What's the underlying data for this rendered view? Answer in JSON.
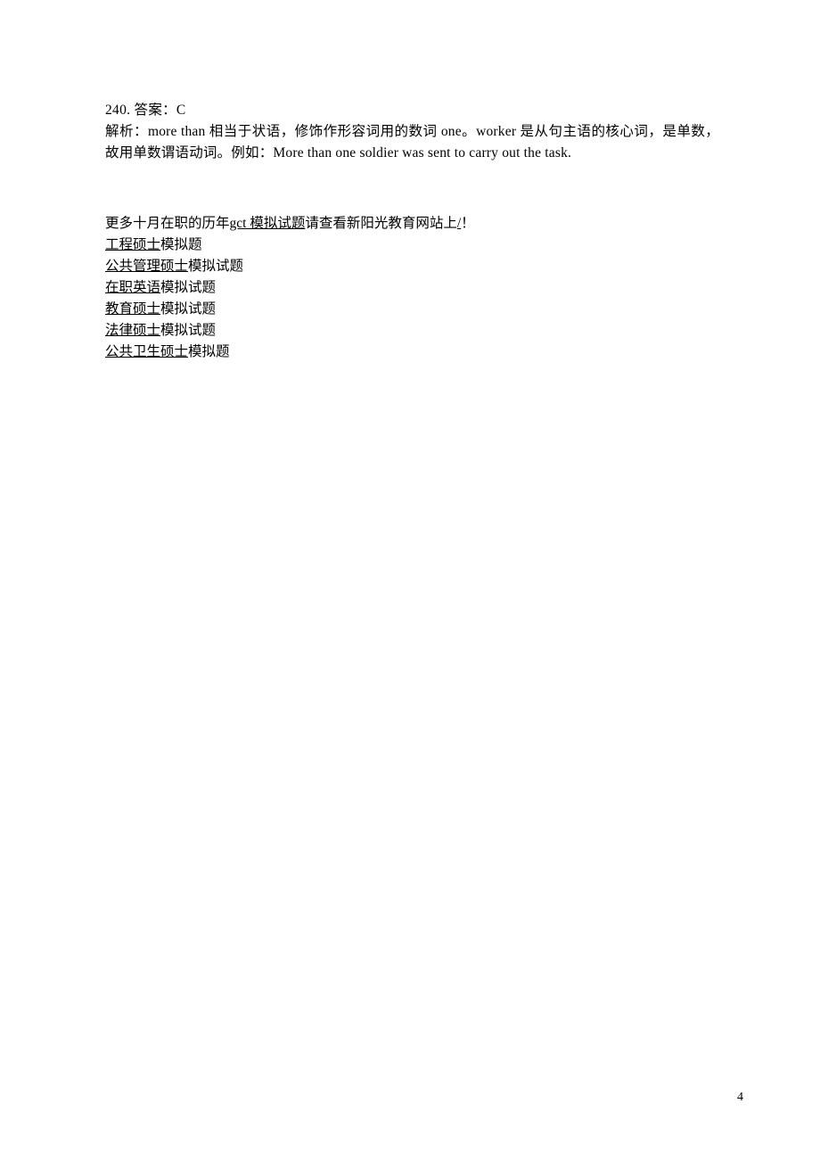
{
  "answer": {
    "number": "240.",
    "label": "答案：",
    "value": "C"
  },
  "explanation": {
    "label": "解析：",
    "part1": "more than 相当于状语，修饰作形容词用的数词 one。worker 是从句主语的核心词，是单数，故用单数谓语动词。例如：More than one soldier was sent to carry out the task."
  },
  "links": {
    "intro_prefix": "更多十月在职的历年",
    "intro_link": "gct 模拟试题",
    "intro_mid": "请查看新阳光教育网站上",
    "intro_slash": "/",
    "intro_suffix": "！",
    "items": [
      {
        "link": "工程硕士",
        "suffix": "模拟题"
      },
      {
        "link": "公共管理硕士",
        "suffix": "模拟试题"
      },
      {
        "link": "在职英语",
        "suffix": "模拟试题"
      },
      {
        "link": "教育硕士",
        "suffix": "模拟试题"
      },
      {
        "link": "法律硕士",
        "suffix": "模拟试题"
      },
      {
        "link": "公共卫生硕士",
        "suffix": "模拟题"
      }
    ]
  },
  "page_number": "4"
}
